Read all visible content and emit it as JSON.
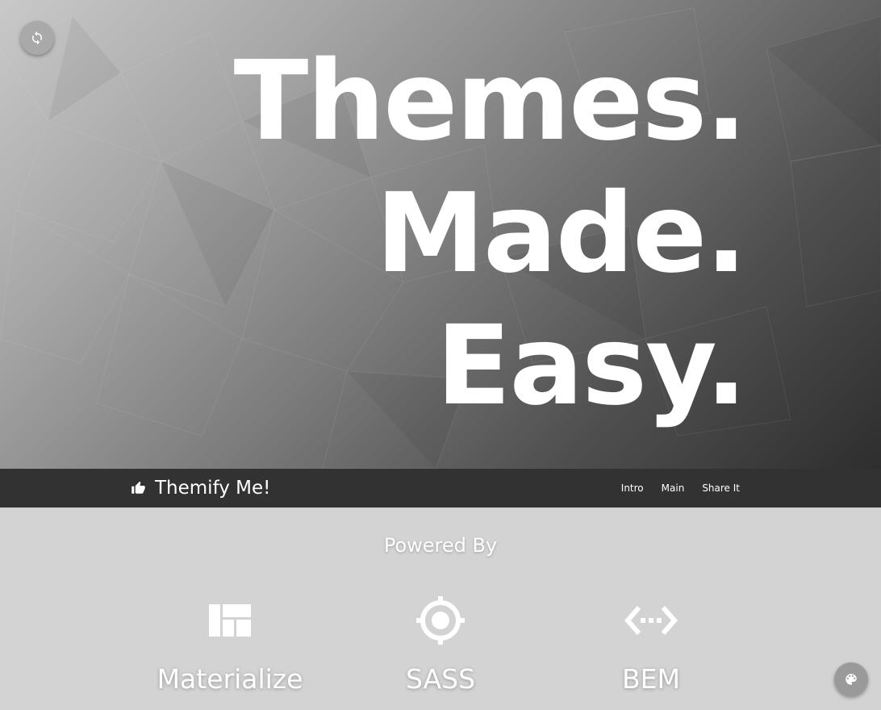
{
  "hero": {
    "line1": "Themes.",
    "line2": "Made.",
    "line3": "Easy."
  },
  "navbar": {
    "brand_label": "Themify Me!",
    "brand_icon": "thumbs-up-icon",
    "links": [
      "Intro",
      "Main",
      "Share It"
    ]
  },
  "powered_section": {
    "heading": "Powered By",
    "items": [
      {
        "label": "Materialize",
        "icon": "layout-icon"
      },
      {
        "label": "SASS",
        "icon": "target-icon"
      },
      {
        "label": "BEM",
        "icon": "code-arrows-icon"
      }
    ]
  },
  "buttons": {
    "refresh_icon": "refresh-icon",
    "palette_icon": "palette-icon"
  },
  "colors": {
    "navbar_bg": "#323232",
    "body_bg": "#d3d3d3",
    "text": "#ffffff"
  }
}
